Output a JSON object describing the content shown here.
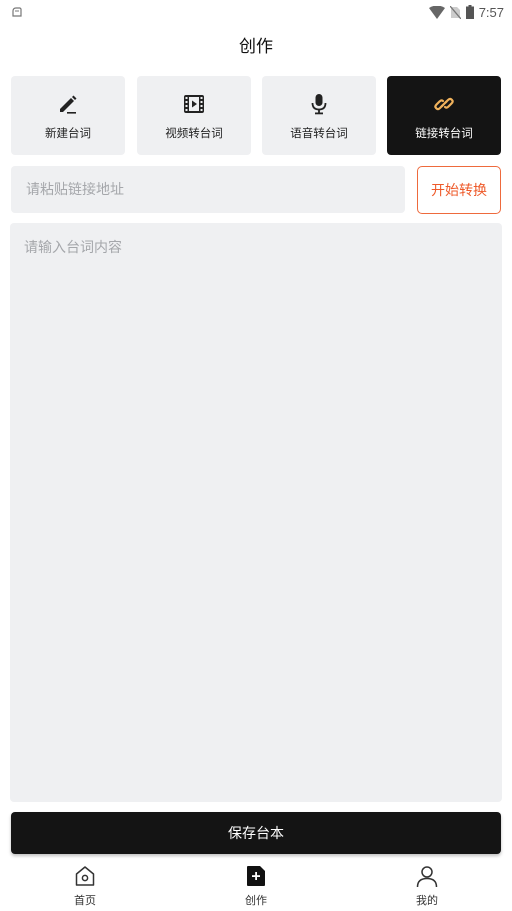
{
  "status_bar": {
    "time": "7:57",
    "icons": [
      "app-notification-icon",
      "wifi-icon",
      "no-sim-icon",
      "battery-icon"
    ]
  },
  "header": {
    "title": "创作"
  },
  "modes": [
    {
      "label": "新建台词",
      "icon": "pencil-icon",
      "active": false
    },
    {
      "label": "视频转台词",
      "icon": "film-icon",
      "active": false
    },
    {
      "label": "语音转台词",
      "icon": "microphone-icon",
      "active": false
    },
    {
      "label": "链接转台词",
      "icon": "link-icon",
      "active": true
    }
  ],
  "link_input": {
    "placeholder": "请粘贴链接地址",
    "value": ""
  },
  "convert_button": {
    "label": "开始转换"
  },
  "content_area": {
    "placeholder": "请输入台词内容",
    "value": ""
  },
  "save_button": {
    "label": "保存台本"
  },
  "bottom_nav": {
    "items": [
      {
        "label": "首页",
        "icon": "home-icon",
        "active": false
      },
      {
        "label": "创作",
        "icon": "create-icon",
        "active": true
      },
      {
        "label": "我的",
        "icon": "profile-icon",
        "active": false
      }
    ]
  },
  "colors": {
    "accent": "#ee5a2a",
    "active_tile": "#141414",
    "link_icon_active": "#f0b25c",
    "panel_bg": "#eff0f2"
  }
}
